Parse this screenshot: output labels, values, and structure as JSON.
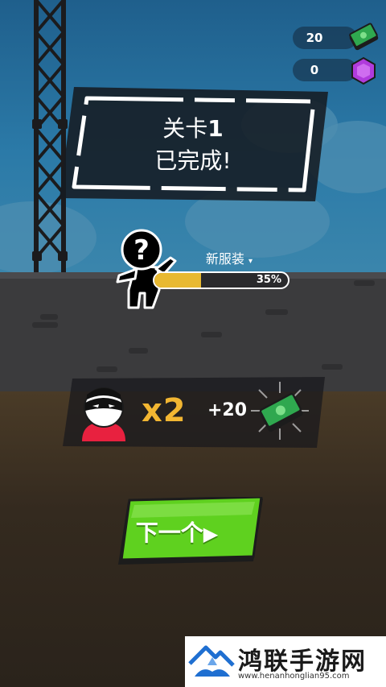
{
  "hud": {
    "cash": "20",
    "gems": "0"
  },
  "level": {
    "prefix": "关卡",
    "number": "1",
    "status": "已完成!"
  },
  "outfit": {
    "label": "新服装",
    "progress_text": "35%",
    "progress": 0.35
  },
  "reward": {
    "multiplier": "x2",
    "bonus": "+20"
  },
  "next_button": {
    "label": "下一个"
  },
  "watermark": {
    "name": "鸿联手游网",
    "url": "www.henanhonglian95.com"
  },
  "colors": {
    "accent_yellow": "#f2b632",
    "button_green": "#5fd11f",
    "progress_fill": "#e8b931"
  },
  "icons": [
    "cash-icon",
    "gem-icon",
    "mystery-outfit-icon",
    "masked-thief-icon",
    "next-arrow-icon"
  ]
}
